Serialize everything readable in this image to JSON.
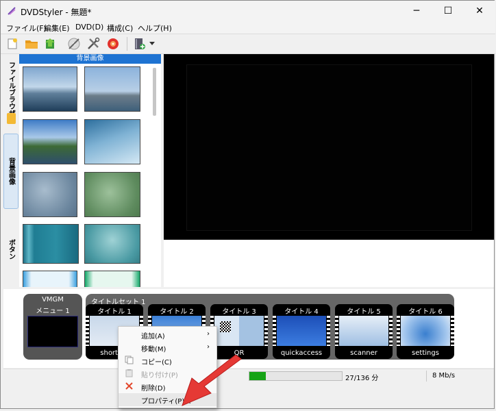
{
  "window": {
    "title": "DVDStyler - 無題*",
    "controls": {
      "minimize": "─",
      "maximize": "☐",
      "close": "✕"
    }
  },
  "menu": [
    "ファイル(F)",
    "編集(E)",
    "DVD(D)",
    "構成(C)",
    "ヘルプ(H)"
  ],
  "toolbar": {
    "icons": [
      "new-icon",
      "open-folder-icon",
      "save-icon",
      "burn-icon",
      "settings-icon",
      "dvd-icon",
      "add-file-icon",
      "dropdown-arrow-icon"
    ]
  },
  "side_tabs": [
    "ファイルブラウザー",
    "背景画像",
    "ボタン"
  ],
  "background_panel": {
    "header": "背景画像"
  },
  "titleset": {
    "vmgm_header": "VMGM",
    "menu_label": "メニュー 1",
    "titleset_header": "タイトルセット 1",
    "titles": [
      {
        "header": "タイトル 1",
        "label": "shortcut"
      },
      {
        "header": "タイトル 2",
        "label": ""
      },
      {
        "header": "タイトル 3",
        "label": "QR"
      },
      {
        "header": "タイトル 4",
        "label": "quickaccess"
      },
      {
        "header": "タイトル 5",
        "label": "scanner"
      },
      {
        "header": "タイトル 6",
        "label": "settings"
      }
    ]
  },
  "status": {
    "size": "27/136 分",
    "bitrate": "8 Mb/s",
    "progress_fraction": 0.18
  },
  "context_menu": {
    "items": [
      {
        "label": "追加(A)",
        "submenu": "›"
      },
      {
        "label": "移動(M)",
        "submenu": "›"
      },
      {
        "label": "コピー(C)"
      },
      {
        "label": "貼り付け(P)"
      },
      {
        "label": "削除(D)"
      },
      {
        "label": "プロパティ(P)..."
      }
    ]
  },
  "colors": {
    "accent": "#1e73d2",
    "progress": "#16a316",
    "arrow": "#e53935"
  }
}
